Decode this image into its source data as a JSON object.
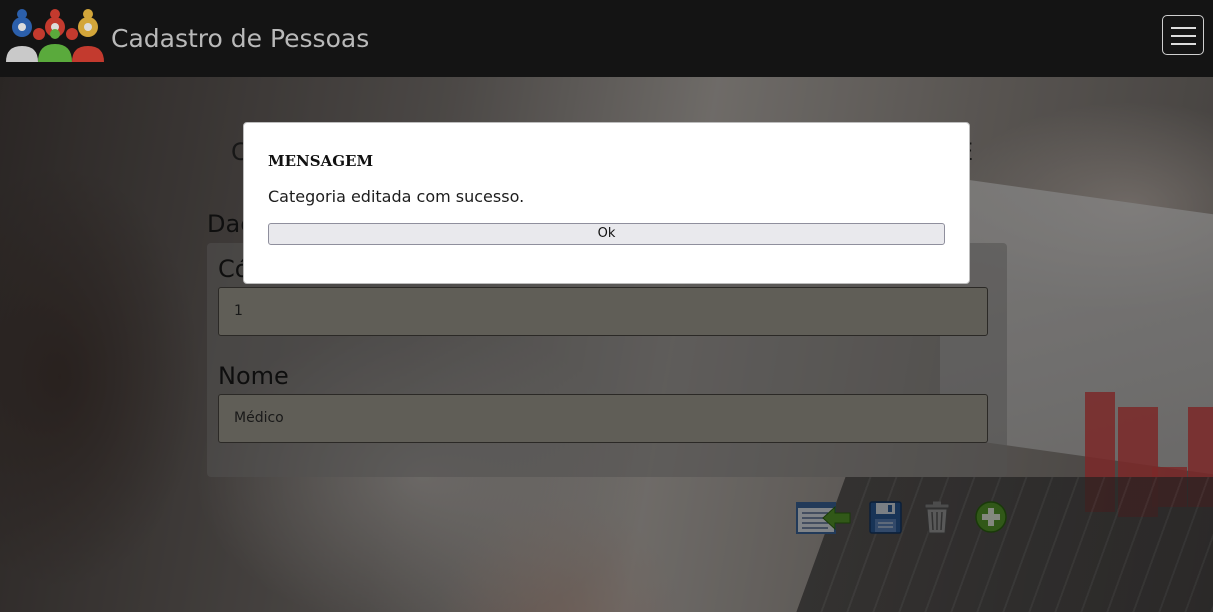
{
  "app": {
    "brand_name": "Cadastro de Pessoas"
  },
  "page": {
    "title_fragment_left": "C",
    "title_fragment_right": "E",
    "section_fragment": "Dac"
  },
  "form": {
    "codigo_label_fragment": "Cód",
    "codigo_value": "1",
    "nome_label": "Nome",
    "nome_value": "Médico"
  },
  "modal": {
    "title": "MENSAGEM",
    "message": "Categoria editada com sucesso.",
    "ok_label": "Ok"
  },
  "actions": [
    {
      "name": "back-to-list",
      "icon": "list-back-arrow-icon"
    },
    {
      "name": "save",
      "icon": "floppy-disk-icon"
    },
    {
      "name": "delete",
      "icon": "trash-icon"
    },
    {
      "name": "add",
      "icon": "plus-circle-icon"
    }
  ],
  "colors": {
    "navbar": "#141414",
    "input_bg": "#afac9e",
    "modal_bg": "#ffffff",
    "add_green": "#5aa02c",
    "save_blue": "#2d5f9e"
  }
}
